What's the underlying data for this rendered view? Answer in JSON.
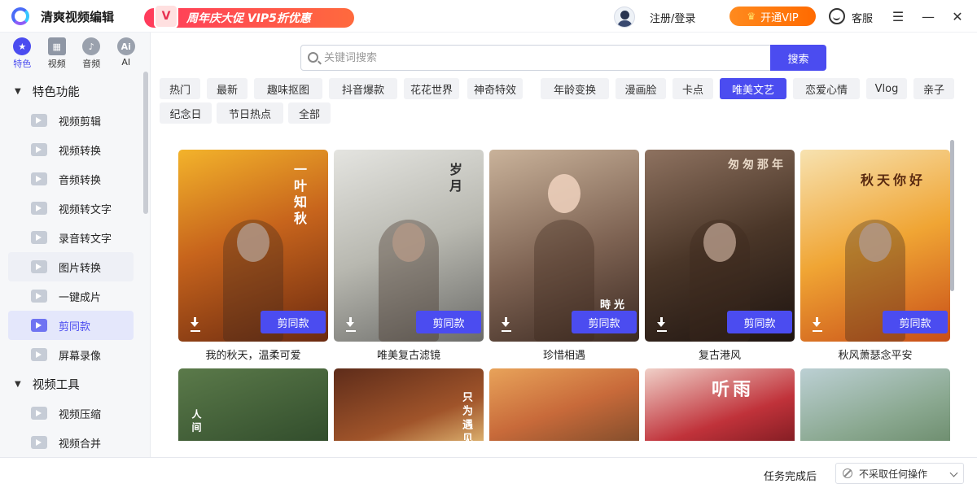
{
  "app": {
    "title": "清爽视频编辑"
  },
  "promo": {
    "badge": "V",
    "text": "周年庆大促 VIP5折优惠"
  },
  "header": {
    "login": "注册/登录",
    "vip_button": "开通VIP",
    "service": "客服"
  },
  "categories": [
    {
      "label": "特色",
      "icon": "star-icon"
    },
    {
      "label": "视频",
      "icon": "film-icon"
    },
    {
      "label": "音频",
      "icon": "audio-icon"
    },
    {
      "label": "AI",
      "icon": "ai-icon"
    }
  ],
  "sidebar": {
    "section1": "特色功能",
    "items1": [
      "视频剪辑",
      "视频转换",
      "音频转换",
      "视频转文字",
      "录音转文字",
      "图片转换",
      "一键成片",
      "剪同款",
      "屏幕录像"
    ],
    "section2": "视频工具",
    "items2": [
      "视频压缩",
      "视频合并"
    ],
    "active_item": "剪同款"
  },
  "search": {
    "placeholder": "关键词搜索",
    "button": "搜索"
  },
  "tags": [
    "热门",
    "最新",
    "趣味抠图",
    "抖音爆款",
    "花花世界",
    "神奇特效",
    "年龄变换",
    "漫画脸",
    "卡点",
    "唯美文艺",
    "恋爱心情",
    "Vlog",
    "亲子",
    "纪念日",
    "节日热点",
    "全部"
  ],
  "active_tag": "唯美文艺",
  "cards": [
    {
      "title": "我的秋天，温柔可爱",
      "button": "剪同款",
      "overlay": "一叶知秋"
    },
    {
      "title": "唯美复古滤镜",
      "button": "剪同款",
      "overlay": "岁月"
    },
    {
      "title": "珍惜相遇",
      "button": "剪同款",
      "overlay": "時光"
    },
    {
      "title": "复古港风",
      "button": "剪同款",
      "overlay": "匆匆那年"
    },
    {
      "title": "秋风萧瑟念平安",
      "button": "剪同款",
      "overlay": "秋天你好"
    }
  ],
  "cards_row2": [
    {
      "overlay": "人间"
    },
    {
      "overlay": "只为遇见"
    },
    {
      "overlay": ""
    },
    {
      "overlay": "听雨"
    },
    {
      "overlay": ""
    }
  ],
  "footer": {
    "label": "任务完成后",
    "select_value": "不采取任何操作"
  },
  "colors": {
    "accent": "#4b4cf0",
    "vip": "#ff7a10",
    "promo": "#ff3b5c"
  }
}
